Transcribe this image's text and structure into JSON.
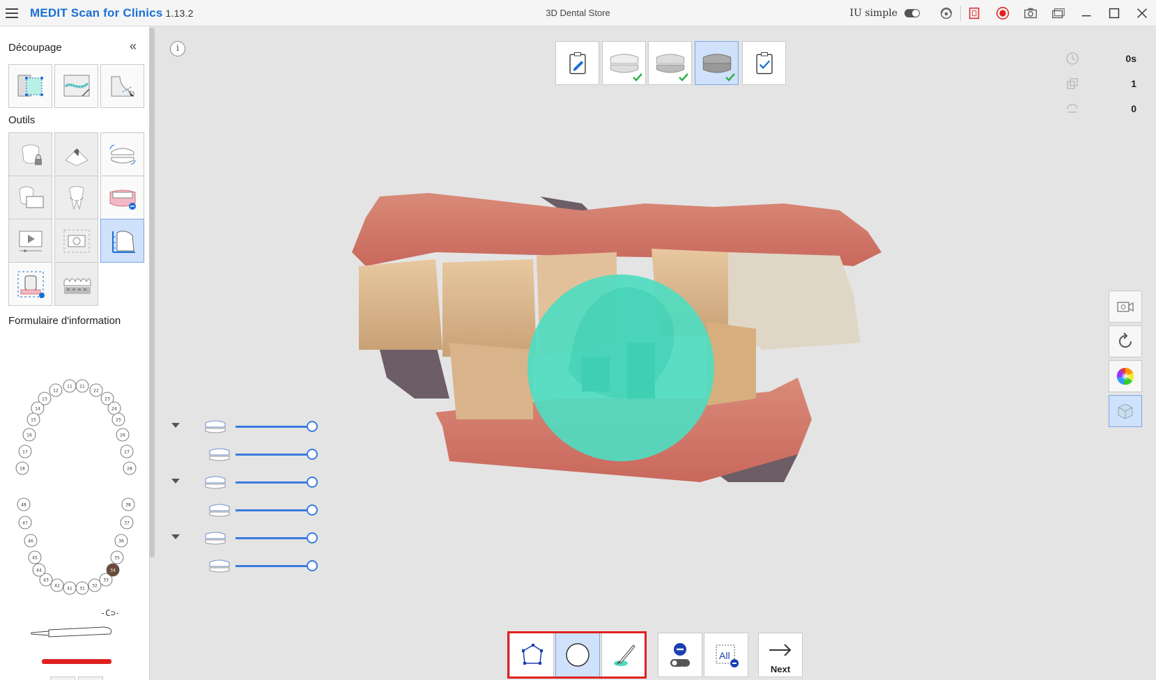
{
  "app": {
    "name": "MEDIT Scan for Clinics",
    "version": "1.13.2",
    "window_title": "3D Dental Store",
    "simple_ui_label": "IU simple"
  },
  "left_panel": {
    "section_trim": "Découpage",
    "section_tools": "Outils",
    "section_form": "Formulaire d'information",
    "collapse_symbol": "«",
    "trim_tools": [
      "area-trim-icon",
      "trim-curve-icon",
      "smart-trim-icon"
    ],
    "tools": [
      {
        "icon": "locked-tooth-icon",
        "state": "disabled"
      },
      {
        "icon": "hyperdent-icon",
        "state": "disabled"
      },
      {
        "icon": "jaw-alignment-icon",
        "state": "normal"
      },
      {
        "icon": "tooth-screen-icon",
        "state": "disabled"
      },
      {
        "icon": "margin-line-icon",
        "state": "disabled"
      },
      {
        "icon": "gingiva-remove-icon",
        "state": "normal"
      },
      {
        "icon": "video-icon",
        "state": "disabled"
      },
      {
        "icon": "camera-icon",
        "state": "disabled"
      },
      {
        "icon": "ruler-measure-icon",
        "state": "active"
      },
      {
        "icon": "abutment-icon",
        "state": "normal"
      },
      {
        "icon": "teeth-texture-icon",
        "state": "disabled"
      }
    ],
    "teeth_upper_right": [
      "11",
      "12",
      "13",
      "14",
      "15",
      "16",
      "17",
      "18"
    ],
    "teeth_upper_left": [
      "21",
      "22",
      "23",
      "24",
      "25",
      "26",
      "27",
      "28"
    ],
    "teeth_lower_right": [
      "41",
      "42",
      "43",
      "44",
      "45",
      "46",
      "47",
      "48"
    ],
    "teeth_lower_left": [
      "31",
      "32",
      "33",
      "34",
      "35",
      "36",
      "37",
      "38"
    ],
    "selected_tooth": "34"
  },
  "stages": [
    {
      "icon": "order-form-icon",
      "done": false,
      "active": false
    },
    {
      "icon": "maxilla-scan-icon",
      "done": true,
      "active": false
    },
    {
      "icon": "mandible-scan-icon",
      "done": true,
      "active": false
    },
    {
      "icon": "occlusion-scan-icon",
      "done": true,
      "active": true
    },
    {
      "icon": "review-checklist-icon",
      "done": false,
      "active": false
    }
  ],
  "stats": {
    "time": "0s",
    "copies": "1",
    "rotations": "0"
  },
  "sliders": [
    {
      "icon": "maxilla-jaw-icon",
      "expandable": true,
      "value": 100
    },
    {
      "icon": "maxilla-sub-icon",
      "expandable": false,
      "value": 100
    },
    {
      "icon": "mandible-jaw-icon",
      "expandable": true,
      "value": 100
    },
    {
      "icon": "mandible-sub-icon",
      "expandable": false,
      "value": 100
    },
    {
      "icon": "occlusion-jaw-icon",
      "expandable": true,
      "value": 100
    },
    {
      "icon": "occlusion-sub-icon",
      "expandable": false,
      "value": 100
    }
  ],
  "right_toolbar": [
    "record-video-icon",
    "reset-view-icon",
    "color-map-icon",
    "view-cube-icon"
  ],
  "bottom_toolbar": {
    "selection_modes": [
      "polygon-select-icon",
      "circle-select-icon",
      "brush-select-icon"
    ],
    "active_mode": "circle-select-icon",
    "toggle_label": "Off",
    "all_label": "All",
    "next_label": "Next"
  },
  "colors": {
    "brand": "#1a6fd6",
    "accent": "#3a7be0",
    "active_bg": "#cfe1fb",
    "selection": "#4fdcc0",
    "highlight_frame": "#e02020"
  }
}
